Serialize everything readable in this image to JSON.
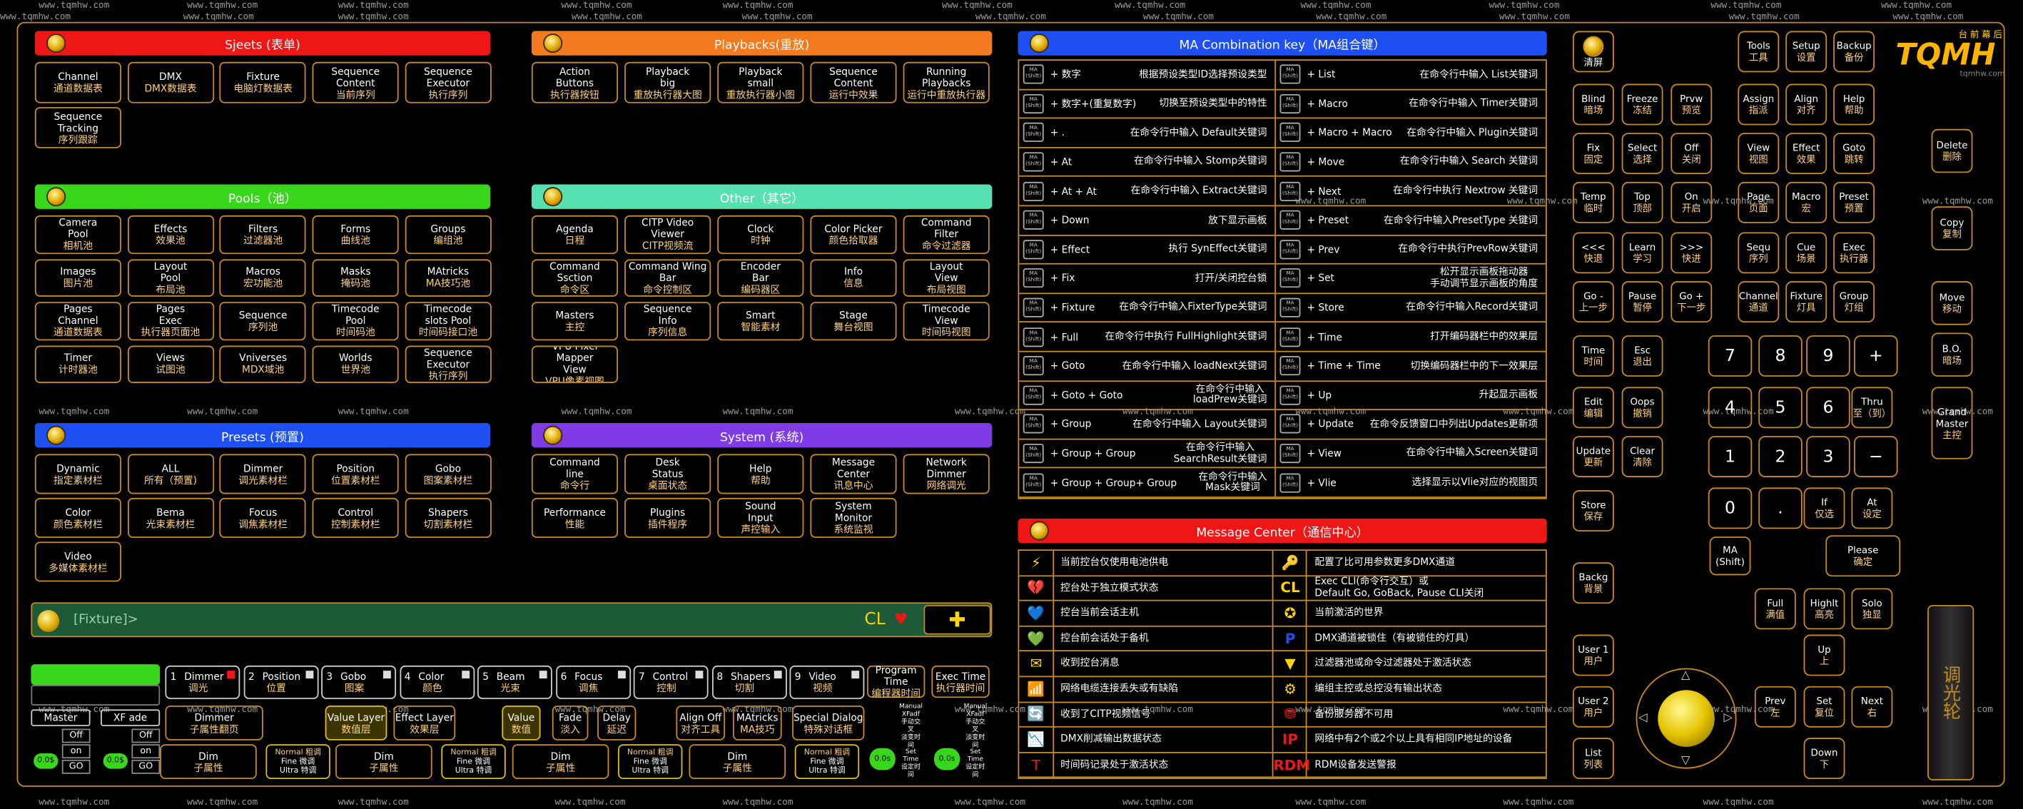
{
  "watermark": "www.tqmhw.com",
  "headers": {
    "sjeets": "Sjeets (表单)",
    "playbacks": "Playbacks(重放)",
    "pools": "Pools（池）",
    "other": "Other（其它）",
    "presets": "Presets (预置)",
    "system": "System (系统)",
    "ma_combo": "MA Combination key（MA组合键）",
    "msg_center": "Message Center（通信中心）"
  },
  "colors": {
    "red": "#ef1616",
    "orange": "#f47a20",
    "green": "#39d71c",
    "teal": "#57e0b0",
    "blue": "#1d4ff2",
    "purple": "#7e3be6",
    "gold": "#c98a1c",
    "yellow": "#ffd400"
  },
  "sjeets": [
    [
      "Channel",
      "通道数据表"
    ],
    [
      "DMX",
      "DMX数据表"
    ],
    [
      "Fixture",
      "电脑灯数据表"
    ],
    [
      "Sequence\nContent",
      "当前序列"
    ],
    [
      "Sequence\nExecutor",
      "执行序列"
    ],
    [
      "Sequence\nTracking",
      "序列跟踪"
    ]
  ],
  "playbacks": [
    [
      "Action\nButtons",
      "执行器按钮"
    ],
    [
      "Playback\nbig",
      "重放执行器大图"
    ],
    [
      "Playback\nsmall",
      "重放执行器小图"
    ],
    [
      "Sequence\nContent",
      "运行中效果"
    ],
    [
      "Running\nPlaybacks",
      "运行中重放执行器"
    ]
  ],
  "pools": [
    [
      "Camera\nPool",
      "相机池"
    ],
    [
      "Effects",
      "效果池"
    ],
    [
      "Filters",
      "过滤器池"
    ],
    [
      "Forms",
      "曲线池"
    ],
    [
      "Groups",
      "编组池"
    ],
    [
      "Images",
      "图片池"
    ],
    [
      "Layout\nPool",
      "布局池"
    ],
    [
      "Macros",
      "宏功能池"
    ],
    [
      "Masks",
      "掩码池"
    ],
    [
      "MAtricks",
      "MA技巧池"
    ],
    [
      "Pages\nChannel",
      "通道数据表"
    ],
    [
      "Pages\nExec",
      "执行器页面池"
    ],
    [
      "Sequence",
      "序列池"
    ],
    [
      "Timecode\nPool",
      "时间码池"
    ],
    [
      "Timecode\nslots Pool",
      "时间码接口池"
    ],
    [
      "Timer",
      "计时器池"
    ],
    [
      "Views",
      "试图池"
    ],
    [
      "Vniverses",
      "MDX域池"
    ],
    [
      "Worlds",
      "世界池"
    ],
    [
      "Sequence\nExecutor",
      "执行序列"
    ]
  ],
  "other": [
    [
      "Agenda",
      "日程"
    ],
    [
      "CITP Video\nViewer",
      "CITP视频流"
    ],
    [
      "Clock",
      "时钟"
    ],
    [
      "Color Picker",
      "颜色拾取器"
    ],
    [
      "Command\nFilter",
      "命令过滤器"
    ],
    [
      "Command\nSsction",
      "命令区"
    ],
    [
      "Command Wing\nBar",
      "命令控制区"
    ],
    [
      "Encoder\nBar",
      "编码器区"
    ],
    [
      "Info",
      "信息"
    ],
    [
      "Layout\nView",
      "布局视图"
    ],
    [
      "Masters",
      "主控"
    ],
    [
      "Sequence\nInfo",
      "序列信息"
    ],
    [
      "Smart",
      "智能素材"
    ],
    [
      "Stage",
      "舞台视图"
    ],
    [
      "Timecode\nView",
      "时间码视图"
    ],
    [
      "VPU Pixel Mapper\nView",
      "VPU像素视图"
    ]
  ],
  "presets": [
    [
      "Dynamic",
      "指定素材栏"
    ],
    [
      "ALL",
      "所有（预置)"
    ],
    [
      "Dimmer",
      "调光素材栏"
    ],
    [
      "Position",
      "位置素材栏"
    ],
    [
      "Gobo",
      "图案素材栏"
    ],
    [
      "Color",
      "颜色素材栏"
    ],
    [
      "Bema",
      "光束素材栏"
    ],
    [
      "Focus",
      "调焦素材栏"
    ],
    [
      "Control",
      "控制素材栏"
    ],
    [
      "Shapers",
      "切割素材栏"
    ],
    [
      "Video",
      "多媒体素材栏"
    ]
  ],
  "system": [
    [
      "Command\nline",
      "命令行"
    ],
    [
      "Desk\nStatus",
      "桌面状态"
    ],
    [
      "Help",
      "帮助"
    ],
    [
      "Message\nCenter",
      "讯息中心"
    ],
    [
      "Network\nDimmer",
      "网络调光"
    ],
    [
      "Performance",
      "性能"
    ],
    [
      "Plugins",
      "插件程序"
    ],
    [
      "Sound\nInput",
      "声控输入"
    ],
    [
      "System\nMonitor",
      "系统监视"
    ]
  ],
  "combo_left": [
    [
      "+ 数字",
      "根据预设类型ID选择预设类型"
    ],
    [
      "+ 数字+(重复数字)",
      "切换至预设类型中的特性"
    ],
    [
      "+ .",
      "在命令行中输入 Default关键词"
    ],
    [
      "+ At",
      "在命令行中输入 Stomp关键词"
    ],
    [
      "+ At + At",
      "在命令行中输入 Extract关键词"
    ],
    [
      "+ Down",
      "放下显示画板"
    ],
    [
      "+ Effect",
      "执行 SynEffect关键词"
    ],
    [
      "+ Fix",
      "打开/关闭控台锁"
    ],
    [
      "+ Fixture",
      "在命令行中输入FixterType关键词"
    ],
    [
      "+ Full",
      "在命令行中执行 FullHighlight关键词"
    ],
    [
      "+ Goto",
      "在命令行中输入 loadNext关键词"
    ],
    [
      "+ Goto + Goto",
      "在命令行中输入\nloadPrew关键词"
    ],
    [
      "+ Group",
      "在命令行中输入 Layout关键词"
    ],
    [
      "+ Group + Group",
      "在命令行中输入\nSearchResult关键词"
    ],
    [
      "+ Group + Group+ Group",
      "在命令行中输入\nMask关键词"
    ]
  ],
  "combo_right": [
    [
      "+ List",
      "在命令行中输入 List关键词"
    ],
    [
      "+ Macro",
      "在命令行中输入 Timer关键词"
    ],
    [
      "+ Macro + Macro",
      "在命令行中输入 Plugin关键词"
    ],
    [
      "+ Move",
      "在命令行中输入 Search 关键词"
    ],
    [
      "+ Next",
      "在命令行中执行 Nextrow 关键词"
    ],
    [
      "+ Preset",
      "在命令行中输入PresetType 关键词"
    ],
    [
      "+ Prev",
      "在命令行中执行PrevRow关键词"
    ],
    [
      "+ Set",
      "松开显示画板拖动器\n手动调节显示画板的角度"
    ],
    [
      "+ Store",
      "在命令行中输入Record关键词"
    ],
    [
      "+ Time",
      "打开编码器栏中的效果层"
    ],
    [
      "+ Time + Time",
      "切换编码器栏中的下一效果层"
    ],
    [
      "+ Up",
      "升起显示画板"
    ],
    [
      "+ Update",
      "在命令反馈窗口中列出Updates更新项"
    ],
    [
      "+ View",
      "在命令行中输入Screen关键词"
    ],
    [
      "+ Vlie",
      "选择显示以Vlie对应的视图页"
    ]
  ],
  "ma_shift_label": "MA\n(Shift)",
  "msg_left": [
    [
      "⚡",
      "当前控台仅使用电池供电"
    ],
    [
      "💔",
      "控台处于独立模式状态"
    ],
    [
      "💙",
      "控台当前会话主机"
    ],
    [
      "💚",
      "控台前会话处于备机"
    ],
    [
      "✉",
      "收到控台消息"
    ],
    [
      "📶",
      "网络电缆连接丢失或有缺陷"
    ],
    [
      "🔄",
      "收到了CITP视频信号"
    ],
    [
      "📉",
      "DMX削减输出数据状态"
    ],
    [
      "T",
      "时间码记录处于激活状态"
    ]
  ],
  "msg_right": [
    [
      "🔑",
      "配置了比可用参数更多DMX通道"
    ],
    [
      "CL",
      "Exec CLI(命令行交互）或\nDefault Go, GoBack, Pause CLI关闭"
    ],
    [
      "✪",
      "当前激活的世界"
    ],
    [
      "P",
      "DMX通道被锁住（有被锁住的灯具）"
    ],
    [
      "▼",
      "过滤器池或命令过滤器处于激活状态"
    ],
    [
      "⚙",
      "编组主控或总控没有输出状态"
    ],
    [
      "⛃",
      "备份服务器不可用"
    ],
    [
      "IP",
      "网络中有2个或2个以上具有相同IP地址的设备"
    ],
    [
      "RDM",
      "RDM设备发送警报"
    ]
  ],
  "cmdline": {
    "text": "[Fixture]>",
    "cl": "CL",
    "plus": "✚"
  },
  "encoders": [
    [
      "1",
      "Dimmer",
      "调光"
    ],
    [
      "2",
      "Position",
      "位置"
    ],
    [
      "3",
      "Gobo",
      "图案"
    ],
    [
      "4",
      "Color",
      "颜色"
    ],
    [
      "5",
      "Beam",
      "光束"
    ],
    [
      "6",
      "Focus",
      "调焦"
    ],
    [
      "7",
      "Control",
      "控制"
    ],
    [
      "8",
      "Shapers",
      "切割"
    ],
    [
      "9",
      "Video",
      "视频"
    ]
  ],
  "bottom": {
    "master": "Master",
    "xfade": "XF ade",
    "off": "Off",
    "on": "on",
    "go": "GO",
    "val": "0.0$",
    "dimmer_page": [
      "Dimmer",
      "子属性翻页"
    ],
    "value_layer": [
      "Value Layer",
      "数值层"
    ],
    "effect_layer": [
      "Effect Layer",
      "效果层"
    ],
    "value": [
      "Value",
      "数值"
    ],
    "fade": [
      "Fade",
      "淡入"
    ],
    "delay": [
      "Delay",
      "延迟"
    ],
    "align_off": [
      "Align Off",
      "对齐工具"
    ],
    "matricks": [
      "MAtricks",
      "MA技巧"
    ],
    "special": [
      "Special Dialog",
      "特殊对话框"
    ],
    "dim": [
      "Dim",
      "子属性"
    ],
    "normal": [
      "Normal 粗调",
      "Fine 微调",
      "Ultra 特调"
    ],
    "prog_time": [
      "Program Time",
      "编程器时间"
    ],
    "exec_time": [
      "Exec Time",
      "执行器时间"
    ],
    "manual": [
      "Manual",
      "XFadf",
      "手动交叉",
      "淡变时间"
    ],
    "settime": [
      "Set",
      "Time",
      "设定时间"
    ],
    "zero": "0.0s"
  },
  "keys": [
    [
      "Tools",
      "工具"
    ],
    [
      "Setup",
      "设置"
    ],
    [
      "Backup",
      "备份"
    ],
    [
      "Blind",
      "暗场"
    ],
    [
      "Freeze",
      "冻结"
    ],
    [
      "Prvw",
      "预览"
    ],
    [
      "Assign",
      "指派"
    ],
    [
      "Align",
      "对齐"
    ],
    [
      "Help",
      "帮助"
    ],
    [
      "Delete",
      "删除"
    ],
    [
      "Fix",
      "固定"
    ],
    [
      "Select",
      "选择"
    ],
    [
      "Off",
      "关闭"
    ],
    [
      "View",
      "视图"
    ],
    [
      "Effect",
      "效果"
    ],
    [
      "Goto",
      "跳转"
    ],
    [
      "Temp",
      "临时"
    ],
    [
      "Top",
      "顶部"
    ],
    [
      "On",
      "开启"
    ],
    [
      "Page",
      "页面"
    ],
    [
      "Macro",
      "宏"
    ],
    [
      "Preset",
      "预置"
    ],
    [
      "Copy",
      "复制"
    ],
    [
      "<<<",
      "快退"
    ],
    [
      "Learn",
      "学习"
    ],
    [
      ">>>",
      "快进"
    ],
    [
      "Sequ",
      "序列"
    ],
    [
      "Cue",
      "场景"
    ],
    [
      "Exec",
      "执行器"
    ],
    [
      "Go -",
      "上一步"
    ],
    [
      "Pause",
      "暂停"
    ],
    [
      "Go +",
      "下一步"
    ],
    [
      "Channel",
      "通道"
    ],
    [
      "Fixture",
      "灯具"
    ],
    [
      "Group",
      "灯组"
    ],
    [
      "Move",
      "移动"
    ],
    [
      "Time",
      "时间"
    ],
    [
      "Esc",
      "退出"
    ],
    [
      "B.O.",
      "暗场"
    ],
    [
      "Edit",
      "编辑"
    ],
    [
      "Oops",
      "撤销"
    ],
    [
      "Thru",
      "至（到）"
    ],
    [
      "Grand\nMaster",
      "主控"
    ],
    [
      "Update",
      "更新"
    ],
    [
      "Clear",
      "清除"
    ],
    [
      "Store",
      "保存"
    ],
    [
      "Backg",
      "背景"
    ],
    [
      "If",
      "仅选"
    ],
    [
      "At",
      "设定"
    ],
    [
      "Please",
      "确定"
    ],
    [
      "Full",
      "满值"
    ],
    [
      "Highlt",
      "高亮"
    ],
    [
      "Solo",
      "独显"
    ],
    [
      "User 1",
      "用户"
    ],
    [
      "User 2",
      "用户"
    ],
    [
      "List",
      "列表"
    ],
    [
      "Up",
      "上"
    ],
    [
      "Prev",
      "左"
    ],
    [
      "Set",
      "复位"
    ],
    [
      "Next",
      "右"
    ],
    [
      "Down",
      "下"
    ],
    [
      "清屏",
      ""
    ]
  ],
  "numpad": [
    "7",
    "8",
    "9",
    "+",
    "4",
    "5",
    "6",
    "Thru",
    "1",
    "2",
    "3",
    "−",
    "0",
    ".",
    "If",
    "At"
  ],
  "logo": {
    "brand": "TQMH",
    "cn": "台前幕后",
    "url": "tqmhw.com",
    "wheel": "调光轮"
  }
}
